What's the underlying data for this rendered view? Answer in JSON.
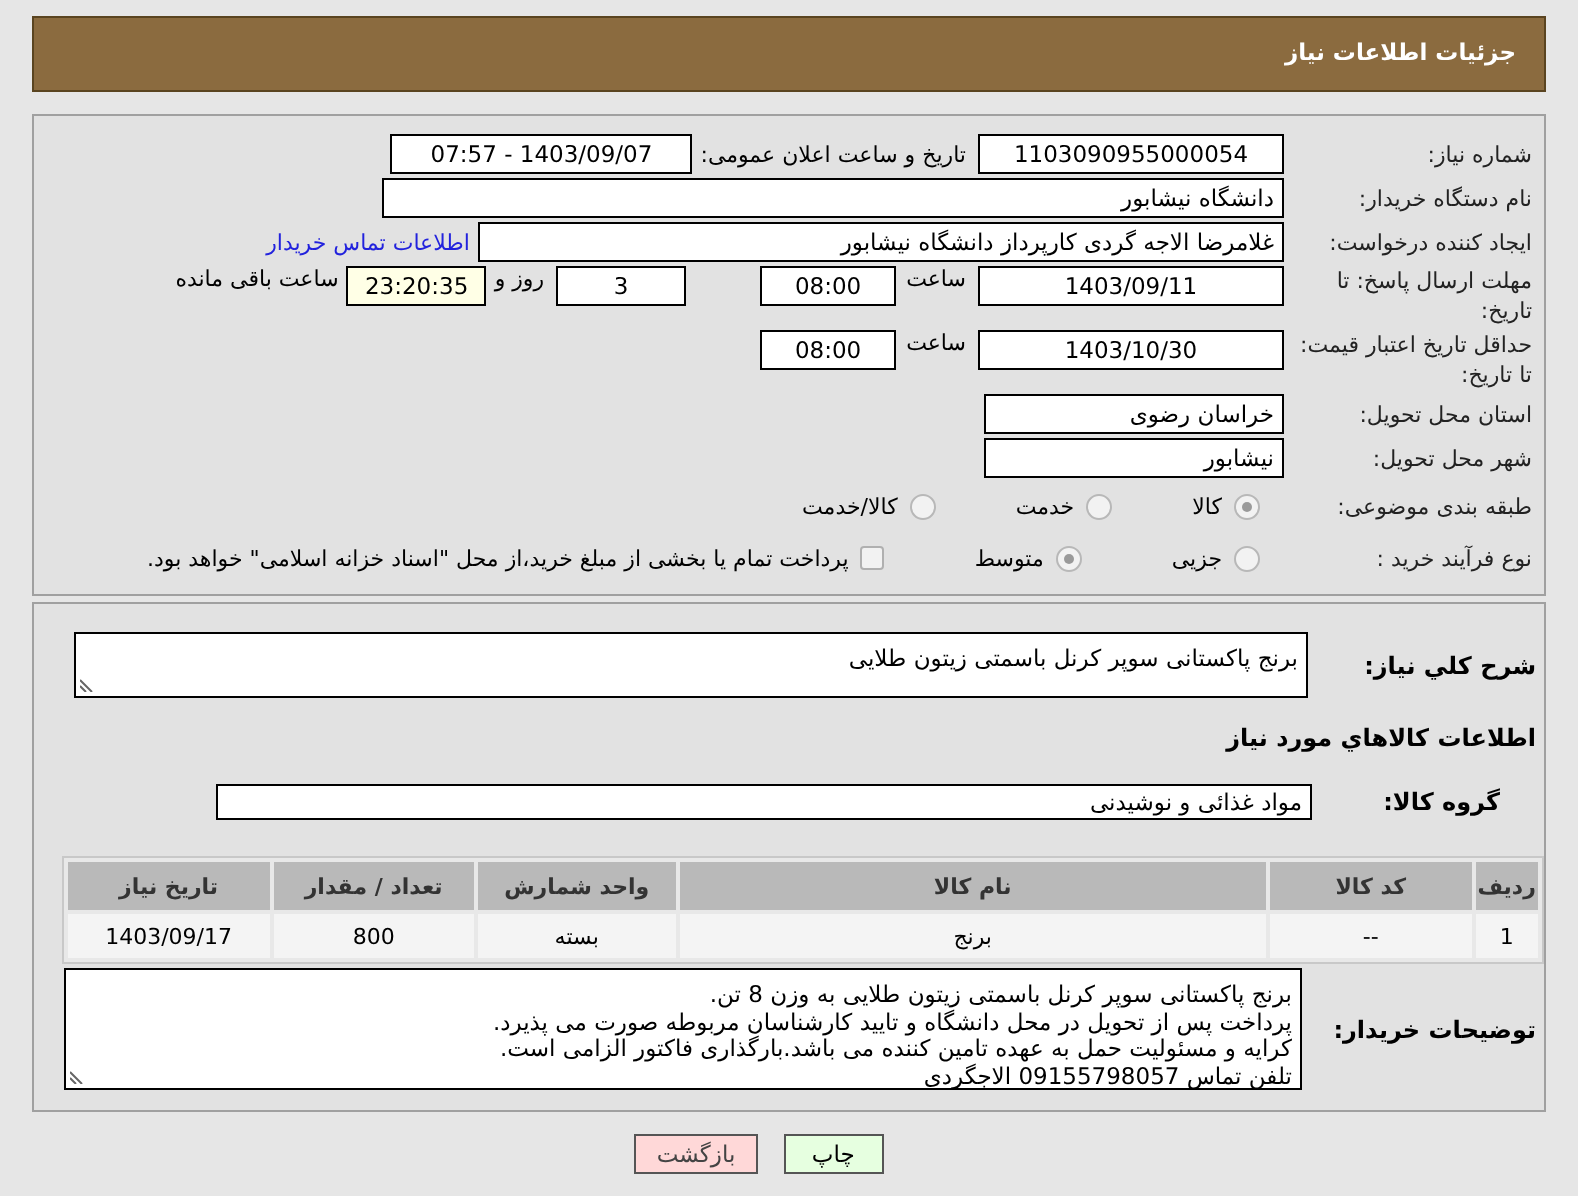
{
  "header": {
    "title": "جزئیات اطلاعات نیاز"
  },
  "need_number": {
    "label": "شماره نیاز:",
    "value": "1103090955000054"
  },
  "announce": {
    "label": "تاریخ و ساعت اعلان عمومی:",
    "value": "1403/09/07 - 07:57"
  },
  "buyer": {
    "label": "نام دستگاه خریدار:",
    "value": "دانشگاه نیشابور"
  },
  "requester": {
    "label": "ایجاد کننده درخواست:",
    "value": "غلامرضا الاجه گردی کارپرداز دانشگاه نیشابور",
    "link": "اطلاعات تماس خریدار"
  },
  "reply_deadline": {
    "label": "مهلت ارسال پاسخ: تا تاریخ:",
    "date": "1403/09/11",
    "time_label": "ساعت",
    "time": "08:00",
    "days": "3",
    "days_label": "روز و",
    "remaining": "23:20:35",
    "remaining_label": "ساعت باقی مانده"
  },
  "price_validity": {
    "label": "حداقل تاریخ اعتبار قیمت: تا تاریخ:",
    "date": "1403/10/30",
    "time_label": "ساعت",
    "time": "08:00"
  },
  "province": {
    "label": "استان محل تحویل:",
    "value": "خراسان رضوی"
  },
  "city": {
    "label": "شهر محل تحویل:",
    "value": "نیشابور"
  },
  "category": {
    "label": "طبقه بندی موضوعی:",
    "options": [
      {
        "label": "کالا",
        "selected": true
      },
      {
        "label": "خدمت",
        "selected": false
      },
      {
        "label": "کالا/خدمت",
        "selected": false
      }
    ]
  },
  "process": {
    "label": "نوع فرآیند خرید :",
    "options": [
      {
        "label": "جزیی",
        "selected": false
      },
      {
        "label": "متوسط",
        "selected": true
      }
    ],
    "payment": {
      "label": "پرداخت تمام یا بخشی از مبلغ خرید،از محل \"اسناد خزانه اسلامی\" خواهد بود.",
      "checked": false
    }
  },
  "description": {
    "label": "شرح كلي نياز:",
    "value": "برنج پاکستانی سوپر کرنل باسمتی زیتون طلایی"
  },
  "items_title": "اطلاعات كالاهاي مورد نياز",
  "goods_group": {
    "label": "گروه کالا:",
    "value": "مواد غذائی و نوشیدنی"
  },
  "table": {
    "columns": [
      "ردیف",
      "کد کالا",
      "نام کالا",
      "واحد شمارش",
      "تعداد / مقدار",
      "تاریخ نیاز"
    ],
    "rows": [
      [
        "1",
        "--",
        "برنج",
        "بسته",
        "800",
        "1403/09/17"
      ]
    ]
  },
  "buyer_notes": {
    "label": "توضیحات خریدار:",
    "lines": [
      "برنج پاکستانی سوپر کرنل باسمتی زیتون طلایی به وزن 8 تن.",
      "پرداخت پس از تحویل در محل دانشگاه و تایید کارشناسان مربوطه صورت می پذیرد.",
      "کرایه و مسئولیت حمل به عهده تامین کننده می باشد.بارگذاری فاکتور الزامی است.",
      "تلفن تماس 09155798057 الاجگردی"
    ]
  },
  "buttons": [
    {
      "label": "چاپ",
      "kind": "print"
    },
    {
      "label": "بازگشت",
      "kind": "back"
    }
  ]
}
